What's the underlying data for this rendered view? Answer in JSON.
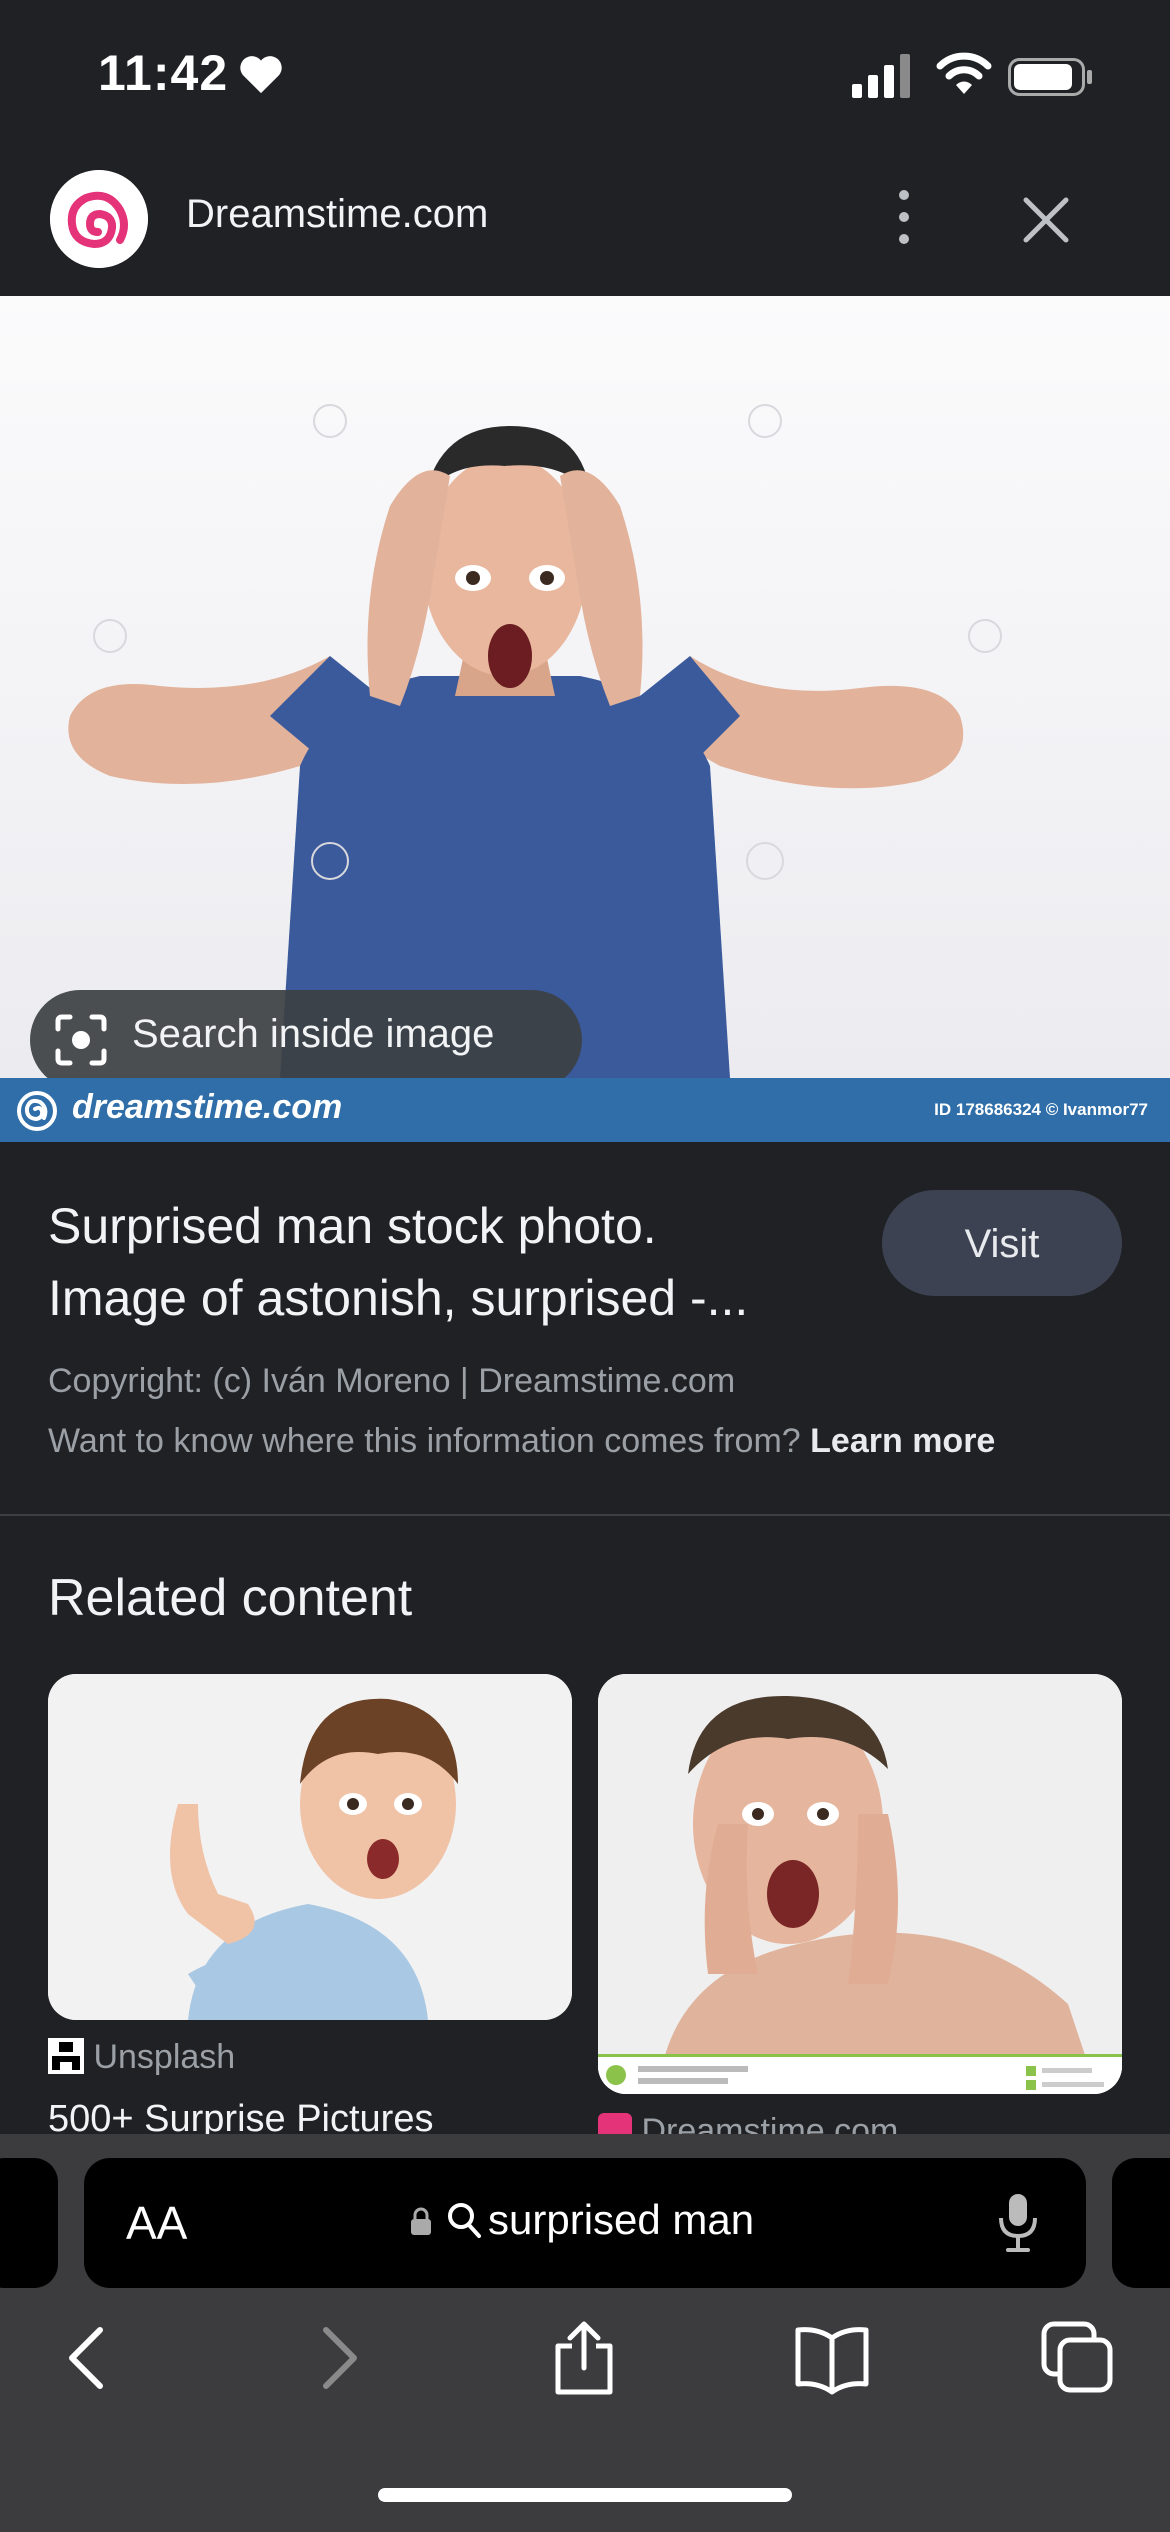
{
  "status_bar": {
    "time": "11:42"
  },
  "header": {
    "site_name": "Dreamstime.com"
  },
  "image": {
    "search_inside_label": "Search inside image",
    "watermark_brand": "dreamstime.com",
    "watermark_id": "ID 178686324 © Ivanmor77"
  },
  "info": {
    "title_line1": "Surprised man stock photo.",
    "title_line2": "Image of astonish, surprised -...",
    "visit_label": "Visit",
    "copyright": "Copyright: (c) Iván Moreno | Dreamstime.com",
    "source_question": "Want to know where this information comes from?",
    "learn_more": "Learn more"
  },
  "related": {
    "heading": "Related content",
    "cards": [
      {
        "source": "Unsplash",
        "title": "500+ Surprise Pictures"
      },
      {
        "source": "Dreamstime.com",
        "title": ""
      }
    ]
  },
  "browser": {
    "text_size_label": "AA",
    "query": "surprised man"
  },
  "colors": {
    "background": "#202124",
    "watermark_bar": "#2f6ea8",
    "visit_button": "#3c4252",
    "brand_pink": "#e5337a"
  },
  "icons": [
    "heart-icon",
    "signal-icon",
    "wifi-icon",
    "battery-icon",
    "more-vert-icon",
    "close-icon",
    "lens-icon",
    "lock-icon",
    "search-icon",
    "mic-icon",
    "back-icon",
    "forward-icon",
    "share-icon",
    "bookmarks-icon",
    "tabs-icon"
  ]
}
